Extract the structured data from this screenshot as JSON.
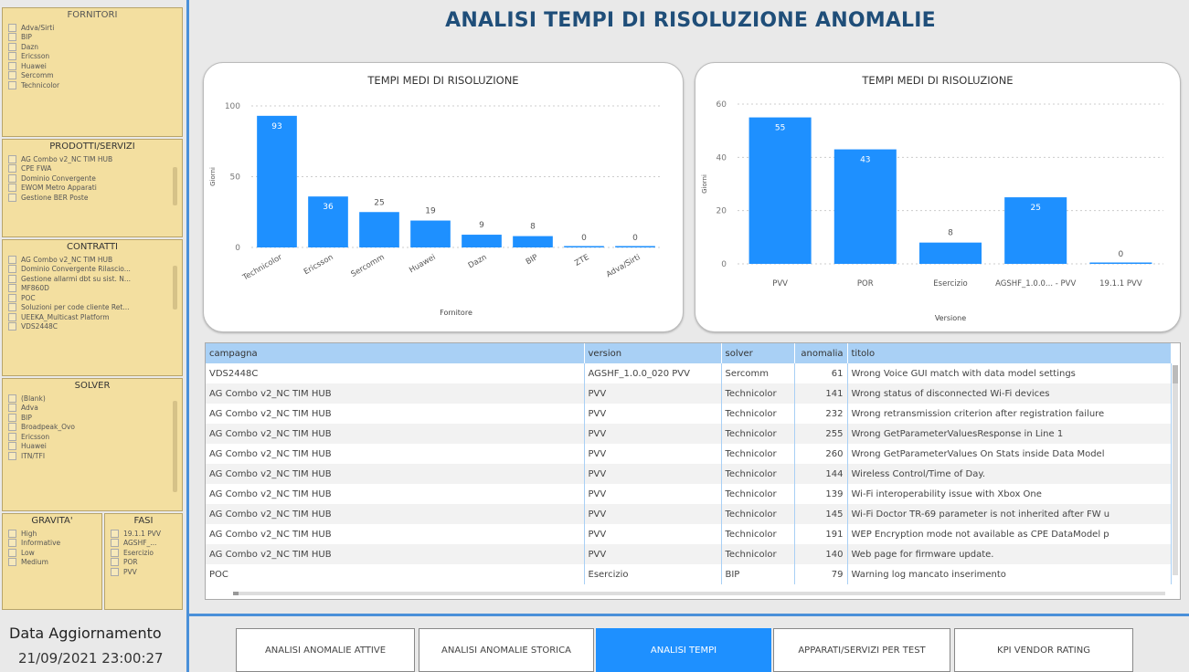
{
  "title": "ANALISI TEMPI DI RISOLUZIONE ANOMALIE",
  "colors": {
    "accent": "#1e90ff",
    "filter_bg": "#f3dfa0",
    "header": "#1f4e79",
    "table_header": "#a9d0f5"
  },
  "filters": {
    "fornitori": {
      "title": "FORNITORI",
      "items": [
        "Adva/Sirti",
        "BIP",
        "Dazn",
        "Ericsson",
        "Huawei",
        "Sercomm",
        "Technicolor"
      ]
    },
    "prodotti": {
      "title": "PRODOTTI/SERVIZI",
      "items": [
        "AG Combo v2_NC TIM HUB",
        "CPE FWA",
        "Dominio Convergente",
        "EWOM Metro Apparati",
        "Gestione BER Poste"
      ]
    },
    "contratti": {
      "title": "CONTRATTI",
      "items": [
        "AG Combo v2_NC TIM HUB",
        "Dominio Convergente Rilascio...",
        "Gestione allarmi dbt su sist. N...",
        "MF860D",
        "POC",
        "Soluzioni per code cliente Ret...",
        "UEEKA_Multicast Platform",
        "VDS2448C"
      ]
    },
    "solver": {
      "title": "SOLVER",
      "items": [
        "(Blank)",
        "Adva",
        "BIP",
        "Broadpeak_Ovo",
        "Ericsson",
        "Huawei",
        "ITN/TFI"
      ]
    },
    "gravita": {
      "title": "GRAVITA'",
      "items": [
        "High",
        "Informative",
        "Low",
        "Medium"
      ]
    },
    "fasi": {
      "title": "FASI",
      "items": [
        "19.1.1 PVV",
        "AGSHF_...",
        "Esercizio",
        "POR",
        "PVV"
      ]
    }
  },
  "update": {
    "label": "Data Aggiornamento",
    "value": "21/09/2021 23:00:27"
  },
  "chart_data": [
    {
      "type": "bar",
      "title": "TEMPI MEDI DI RISOLUZIONE",
      "xlabel": "Fornitore",
      "ylabel": "Giorni",
      "categories": [
        "Technicolor",
        "Ericsson",
        "Sercomm",
        "Huawei",
        "Dazn",
        "BIP",
        "ZTE",
        "Adva/Sirti"
      ],
      "values": [
        93,
        36,
        25,
        19,
        9,
        8,
        0,
        0
      ],
      "yticks": [
        0,
        50,
        100
      ],
      "ylim": [
        0,
        100
      ],
      "grid": true,
      "color": "#1e90ff"
    },
    {
      "type": "bar",
      "title": "TEMPI MEDI DI RISOLUZIONE",
      "xlabel": "Versione",
      "ylabel": "Giorni",
      "categories": [
        "PVV",
        "POR",
        "Esercizio",
        "AGSHF_1.0.0... - PVV",
        "19.1.1 PVV"
      ],
      "values": [
        55,
        43,
        8,
        25,
        0
      ],
      "yticks": [
        0,
        20,
        40,
        60
      ],
      "ylim": [
        0,
        60
      ],
      "grid": true,
      "color": "#1e90ff"
    }
  ],
  "table": {
    "columns": [
      "campagna",
      "version",
      "solver",
      "anomalia",
      "titolo"
    ],
    "rows": [
      [
        "VDS2448C",
        "AGSHF_1.0.0_020 PVV",
        "Sercomm",
        "61",
        "Wrong Voice GUI match with data model settings"
      ],
      [
        "AG Combo v2_NC TIM HUB",
        "PVV",
        "Technicolor",
        "141",
        "Wrong status of disconnected Wi-Fi devices"
      ],
      [
        "AG Combo v2_NC TIM HUB",
        "PVV",
        "Technicolor",
        "232",
        "Wrong retransmission criterion after registration failure"
      ],
      [
        "AG Combo v2_NC TIM HUB",
        "PVV",
        "Technicolor",
        "255",
        "Wrong GetParameterValuesResponse in Line 1"
      ],
      [
        "AG Combo v2_NC TIM HUB",
        "PVV",
        "Technicolor",
        "260",
        "Wrong GetParameterValues On Stats inside Data Model"
      ],
      [
        "AG Combo v2_NC TIM HUB",
        "PVV",
        "Technicolor",
        "144",
        "Wireless Control/Time of Day."
      ],
      [
        "AG Combo v2_NC TIM HUB",
        "PVV",
        "Technicolor",
        "139",
        "Wi-Fi interoperability issue with Xbox One"
      ],
      [
        "AG Combo v2_NC TIM HUB",
        "PVV",
        "Technicolor",
        "145",
        "Wi-Fi Doctor TR-69 parameter is not inherited after FW u"
      ],
      [
        "AG Combo v2_NC TIM HUB",
        "PVV",
        "Technicolor",
        "191",
        "WEP Encryption mode not available as CPE DataModel p"
      ],
      [
        "AG Combo v2_NC TIM HUB",
        "PVV",
        "Technicolor",
        "140",
        "Web page for firmware update."
      ],
      [
        "POC",
        "Esercizio",
        "BIP",
        "79",
        "Warning log mancato inserimento"
      ]
    ]
  },
  "tabs": [
    "ANALISI ANOMALIE ATTIVE",
    "ANALISI ANOMALIE STORICA",
    "ANALISI TEMPI",
    "APPARATI/SERVIZI PER TEST",
    "KPI VENDOR RATING"
  ],
  "active_tab": "ANALISI TEMPI"
}
